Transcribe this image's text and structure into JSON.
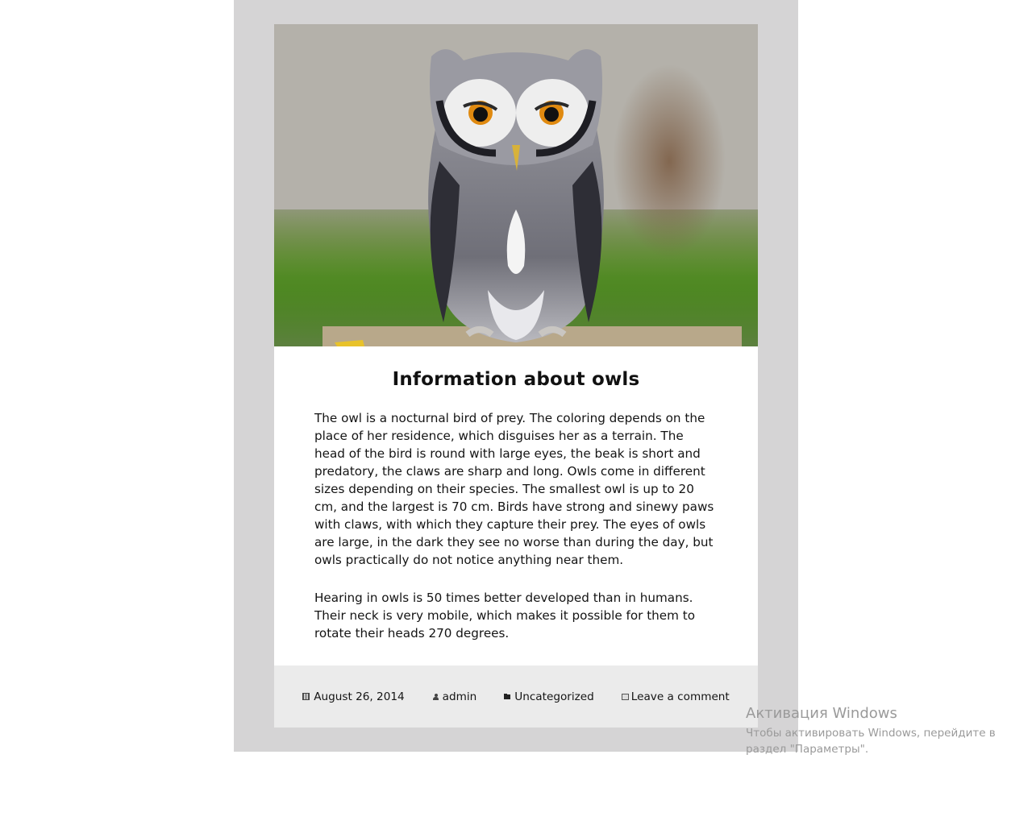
{
  "post": {
    "image_alt": "owl-photo",
    "title": "Information about owls",
    "paragraphs": [
      "The owl is a nocturnal bird of prey. The coloring depends on the place of her residence, which disguises her as a terrain. The head of the bird is round with large eyes, the beak is short and predatory, the claws are sharp and long. Owls come in different sizes depending on their species. The smallest owl is up to 20 cm, and the largest is 70 cm. Birds have strong and sinewy paws with claws, with which they capture their prey. The eyes of owls are large, in the dark they see no worse than during the day, but owls practically do not notice anything near them.",
      "Hearing in owls is 50 times better developed than in humans. Their neck is very mobile, which makes it possible for them to rotate their heads 270 degrees."
    ],
    "meta": {
      "date": "August 26, 2014",
      "author": "admin",
      "category": "Uncategorized",
      "comment": "Leave a comment"
    }
  },
  "watermark": {
    "title": "Активация Windows",
    "text": "Чтобы активировать Windows, перейдите в раздел \"Параметры\"."
  },
  "colors": {
    "frame": "#d5d4d5",
    "meta_bg": "#ebebeb",
    "text": "#141414",
    "watermark": "#9a9a9a"
  }
}
